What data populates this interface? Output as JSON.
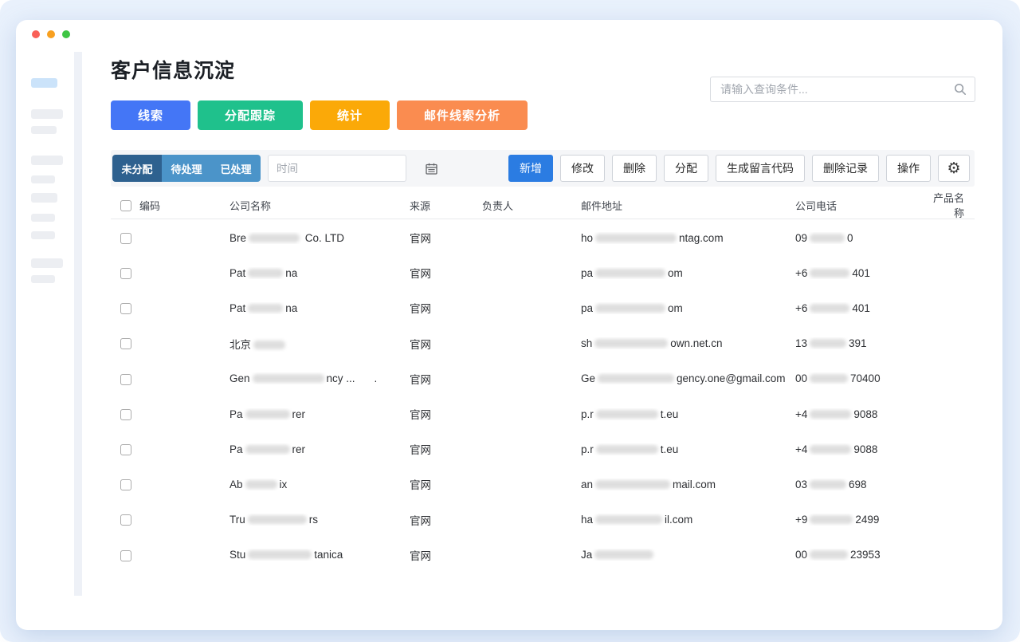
{
  "window": {
    "traffic_lights": [
      "#f96057",
      "#f8a020",
      "#3ec544"
    ]
  },
  "header": {
    "title": "客户信息沉淀"
  },
  "search": {
    "placeholder": "请输入查询条件..."
  },
  "nav_buttons": [
    {
      "id": "leads",
      "label": "线索",
      "color": "#4476f6"
    },
    {
      "id": "assign-track",
      "label": "分配跟踪",
      "color": "#1fc18c"
    },
    {
      "id": "stats",
      "label": "统计",
      "color": "#fba908"
    },
    {
      "id": "email-lead-analysis",
      "label": "邮件线索分析",
      "color": "#fa8c50"
    }
  ],
  "toolbar": {
    "tabs": [
      {
        "id": "unassigned",
        "label": "未分配",
        "active": true
      },
      {
        "id": "pending",
        "label": "待处理",
        "active": false
      },
      {
        "id": "processed",
        "label": "已处理",
        "active": false
      }
    ],
    "time_placeholder": "时间",
    "actions": [
      {
        "id": "add",
        "label": "新增",
        "primary": true
      },
      {
        "id": "modify",
        "label": "修改",
        "primary": false
      },
      {
        "id": "delete",
        "label": "删除",
        "primary": false
      },
      {
        "id": "assign",
        "label": "分配",
        "primary": false
      },
      {
        "id": "generate-message-code",
        "label": "生成留言代码",
        "primary": false
      },
      {
        "id": "delete-records",
        "label": "删除记录",
        "primary": false
      },
      {
        "id": "operate",
        "label": "操作",
        "primary": false
      }
    ]
  },
  "table": {
    "columns": [
      "编码",
      "公司名称",
      "来源",
      "负责人",
      "邮件地址",
      "公司电话",
      "产品名称"
    ],
    "rows": [
      {
        "company": [
          {
            "t": "Bre"
          },
          {
            "r": 64
          },
          {
            "t": " Co. LTD"
          }
        ],
        "source": "官网",
        "email": [
          {
            "t": "ho"
          },
          {
            "r": 102
          },
          {
            "t": "ntag.com"
          }
        ],
        "phone": [
          {
            "t": "09"
          },
          {
            "r": 44
          },
          {
            "t": "0"
          }
        ]
      },
      {
        "company": [
          {
            "t": "Pat"
          },
          {
            "r": 44
          },
          {
            "t": "na"
          }
        ],
        "source": "官网",
        "email": [
          {
            "t": "pa"
          },
          {
            "r": 88
          },
          {
            "t": "om"
          }
        ],
        "phone": [
          {
            "t": "+6"
          },
          {
            "r": 50
          },
          {
            "t": "401"
          }
        ]
      },
      {
        "company": [
          {
            "t": "Pat"
          },
          {
            "r": 44
          },
          {
            "t": "na"
          }
        ],
        "source": "官网",
        "email": [
          {
            "t": "pa"
          },
          {
            "r": 88
          },
          {
            "t": "om"
          }
        ],
        "phone": [
          {
            "t": "+6"
          },
          {
            "r": 50
          },
          {
            "t": "401"
          }
        ]
      },
      {
        "company": [
          {
            "t": "北京"
          },
          {
            "r": 40
          }
        ],
        "source": "官网",
        "email": [
          {
            "t": "sh"
          },
          {
            "r": 92
          },
          {
            "t": "own.net.cn"
          }
        ],
        "phone": [
          {
            "t": "13"
          },
          {
            "r": 46
          },
          {
            "t": "391"
          }
        ]
      },
      {
        "company": [
          {
            "t": "Gen"
          },
          {
            "r": 90
          },
          {
            "t": "ncy ..."
          },
          {
            "g": 24
          },
          {
            "t": "."
          }
        ],
        "source": "官网",
        "email": [
          {
            "t": "Ge"
          },
          {
            "r": 96
          },
          {
            "t": "gency.one@gmail.com"
          }
        ],
        "phone": [
          {
            "t": "00"
          },
          {
            "r": 48
          },
          {
            "t": "70400"
          }
        ]
      },
      {
        "company": [
          {
            "t": "Pa"
          },
          {
            "r": 56
          },
          {
            "t": "rer"
          }
        ],
        "source": "官网",
        "email": [
          {
            "t": "p.r"
          },
          {
            "r": 78
          },
          {
            "t": "t.eu"
          }
        ],
        "phone": [
          {
            "t": "+4"
          },
          {
            "r": 52
          },
          {
            "t": "9088"
          }
        ]
      },
      {
        "company": [
          {
            "t": "Pa"
          },
          {
            "r": 56
          },
          {
            "t": "rer"
          }
        ],
        "source": "官网",
        "email": [
          {
            "t": "p.r"
          },
          {
            "r": 78
          },
          {
            "t": "t.eu"
          }
        ],
        "phone": [
          {
            "t": "+4"
          },
          {
            "r": 52
          },
          {
            "t": "9088"
          }
        ]
      },
      {
        "company": [
          {
            "t": "Ab"
          },
          {
            "r": 40
          },
          {
            "t": "ix"
          }
        ],
        "source": "官网",
        "email": [
          {
            "t": "an"
          },
          {
            "r": 94
          },
          {
            "t": "mail.com"
          }
        ],
        "phone": [
          {
            "t": "03"
          },
          {
            "r": 46
          },
          {
            "t": "698"
          }
        ]
      },
      {
        "company": [
          {
            "t": "Tru"
          },
          {
            "r": 74
          },
          {
            "t": "rs"
          }
        ],
        "source": "官网",
        "email": [
          {
            "t": "ha"
          },
          {
            "r": 84
          },
          {
            "t": "il.com"
          }
        ],
        "phone": [
          {
            "t": "+9"
          },
          {
            "r": 54
          },
          {
            "t": "2499"
          }
        ]
      },
      {
        "company": [
          {
            "t": "Stu"
          },
          {
            "r": 80
          },
          {
            "t": "tanica"
          }
        ],
        "source": "官网",
        "email": [
          {
            "t": "Ja"
          },
          {
            "r": 74
          }
        ],
        "phone": [
          {
            "t": "00"
          },
          {
            "r": 48
          },
          {
            "t": "23953"
          }
        ]
      }
    ]
  }
}
